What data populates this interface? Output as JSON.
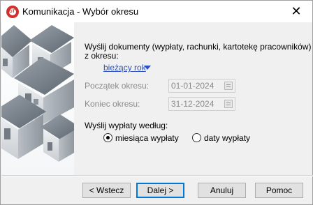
{
  "window": {
    "title": "Komunikacja - Wybór okresu",
    "app_icon_text": "GT",
    "close_glyph": "✕"
  },
  "form": {
    "intro_line1": "Wyślij dokumenty (wypłaty, rachunki, kartotekę pracowników)",
    "intro_line2": "z okresu:",
    "period_selected": "bieżący rok",
    "start_label": "Początek okresu:",
    "start_value": "01-01-2024",
    "end_label": "Koniec okresu:",
    "end_value": "31-12-2024",
    "send_by_label": "Wyślij wypłaty według:",
    "radio_month_label": "miesiąca wypłaty",
    "radio_month_checked": true,
    "radio_date_label": "daty wypłaty",
    "radio_date_checked": false
  },
  "buttons": {
    "back": "< Wstecz",
    "next": "Dalej >",
    "cancel": "Anuluj",
    "help": "Pomoc"
  },
  "colors": {
    "link": "#2b4fc2",
    "default_button_border": "#0078d7"
  },
  "icons": [
    "app-logo-icon",
    "close-icon",
    "houses-illustration",
    "calendar-icon",
    "dropdown-arrow-icon"
  ]
}
